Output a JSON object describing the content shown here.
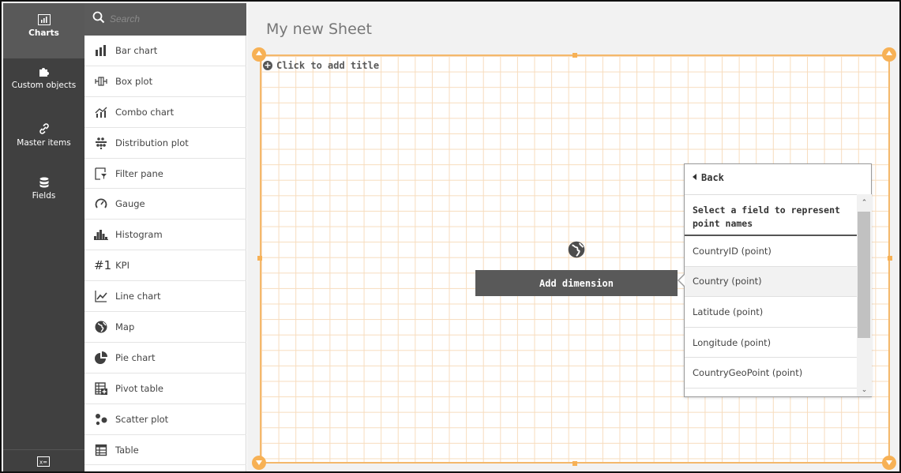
{
  "rail": {
    "items": [
      {
        "label": "Charts",
        "icon": "charts-icon"
      },
      {
        "label": "Custom objects",
        "icon": "puzzle-icon"
      },
      {
        "label": "Master items",
        "icon": "link-icon"
      },
      {
        "label": "Fields",
        "icon": "database-icon"
      }
    ],
    "bottom_icon": "variables-icon"
  },
  "search": {
    "placeholder": "Search"
  },
  "charts": [
    {
      "label": "Bar chart",
      "icon": "bar-chart-icon"
    },
    {
      "label": "Box plot",
      "icon": "box-plot-icon"
    },
    {
      "label": "Combo chart",
      "icon": "combo-chart-icon"
    },
    {
      "label": "Distribution plot",
      "icon": "distribution-plot-icon"
    },
    {
      "label": "Filter pane",
      "icon": "filter-pane-icon"
    },
    {
      "label": "Gauge",
      "icon": "gauge-icon"
    },
    {
      "label": "Histogram",
      "icon": "histogram-icon"
    },
    {
      "label": "KPI",
      "icon": "kpi-icon",
      "glyph": "#1"
    },
    {
      "label": "Line chart",
      "icon": "line-chart-icon"
    },
    {
      "label": "Map",
      "icon": "map-icon"
    },
    {
      "label": "Pie chart",
      "icon": "pie-chart-icon"
    },
    {
      "label": "Pivot table",
      "icon": "pivot-table-icon"
    },
    {
      "label": "Scatter plot",
      "icon": "scatter-plot-icon"
    },
    {
      "label": "Table",
      "icon": "table-icon"
    }
  ],
  "sheet": {
    "title": "My new Sheet",
    "add_title": "Click to add title",
    "add_dimension": "Add dimension",
    "accent": "#f7b155"
  },
  "popover": {
    "back": "Back",
    "heading": "Select a field to represent point names",
    "fields": [
      "CountryID (point)",
      "Country (point)",
      "Latitude (point)",
      "Longitude (point)",
      "CountryGeoPoint (point)"
    ],
    "hovered_index": 1
  }
}
